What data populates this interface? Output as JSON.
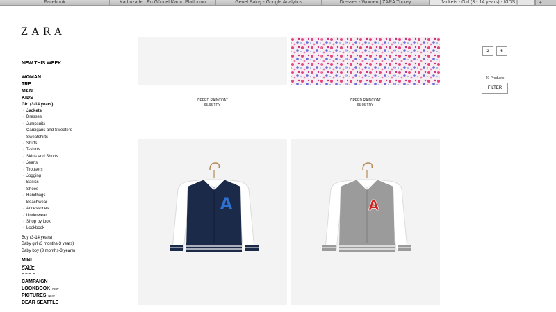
{
  "browser": {
    "tabs": [
      {
        "label": "Facebook"
      },
      {
        "label": "Kadınzade | En Güncel Kadın Platformu"
      },
      {
        "label": "Genel Bakış - Google Analytics"
      },
      {
        "label": "Dresses - Women | ZARA Turkey"
      },
      {
        "label": "Jackets - Girl (3 - 14 years) - KIDS | ..."
      }
    ],
    "new_tab": "+"
  },
  "logo": "ZARA",
  "nav": {
    "new_this_week": "NEW THIS WEEK",
    "woman": "WOMAN",
    "trf": "TRF",
    "man": "MAN",
    "kids": "KIDS",
    "girl": "Girl (3-14 years)",
    "girl_items": [
      "Jackets",
      "Dresses",
      "Jumpsuits",
      "Cardigans and Sweaters",
      "Sweatshirts",
      "Shirts",
      "T-shirts",
      "Skirts and Shorts",
      "Jeans",
      "Trousers",
      "Jogging",
      "Basics",
      "Shoes",
      "Handbags",
      "Beachwear",
      "Accessories",
      "Underwear",
      "Shop by look",
      "Lookbook"
    ],
    "boy": "Boy (3-14 years)",
    "baby_girl": "Baby girl (3 months-3 years)",
    "baby_boy": "Baby boy (3 months-3 years)",
    "mini": "MINI",
    "sale": "SALE",
    "campaign": "CAMPAIGN",
    "lookbook": "LOOKBOOK",
    "pictures": "PICTURES",
    "dear_seattle": "DEAR SEATTLE",
    "new_tag": "NEW"
  },
  "products": [
    {
      "name": "ZIPPED RAINCOAT",
      "price": "65.95 TRY"
    },
    {
      "name": "ZIPPED RAINCOAT",
      "price": "65.95 TRY"
    },
    {
      "name": "",
      "price": "",
      "letter": "A"
    },
    {
      "name": "",
      "price": "",
      "letter": "A"
    }
  ],
  "pagination": {
    "page2": "2",
    "page6": "6"
  },
  "product_count": "40 Products",
  "filter_label": "FILTER",
  "colors": {
    "navy": "#1c2a4a",
    "grey": "#9b9b9b",
    "patch_blue": "#2f6fd0",
    "patch_red": "#cc2222"
  }
}
